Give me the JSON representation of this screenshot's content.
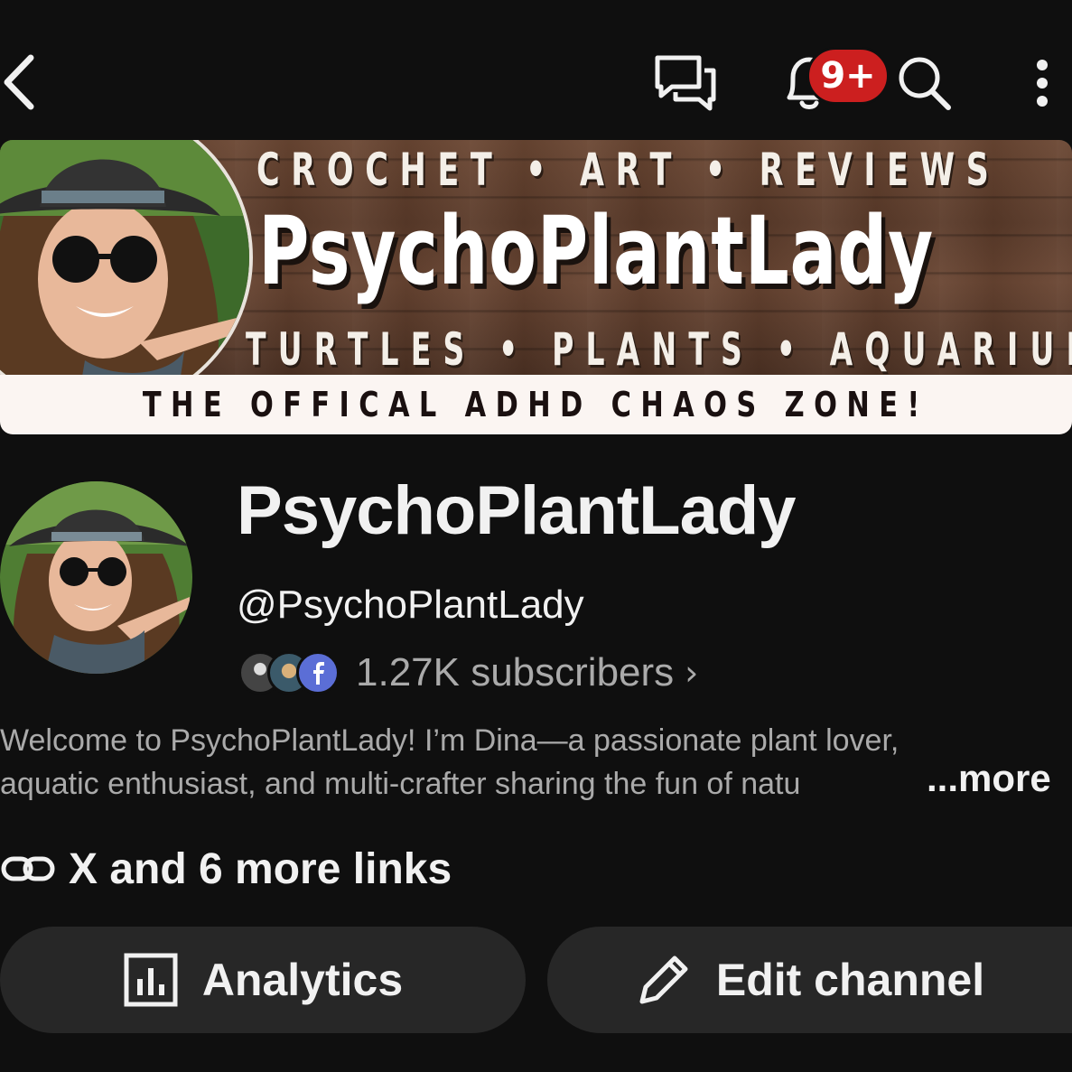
{
  "topbar": {
    "back_icon": "chevron-left-icon",
    "icons": [
      "chat-icon",
      "bell-icon",
      "search-icon",
      "more-vert-icon"
    ],
    "notification_badge": "9+",
    "badge_color": "#cc1f1f"
  },
  "banner": {
    "top_line": "CROCHET • ART • REVIEWS",
    "title": "PsychoPlantLady",
    "bottom_line": "TURTLES • PLANTS • AQUARIUMS",
    "strip_text": "THE OFFICAL ADHD CHAOS ZONE!"
  },
  "profile": {
    "channel_name": "PsychoPlantLady",
    "handle": "@PsychoPlantLady",
    "subscribers": "1.27K subscribers",
    "description_line1": "Welcome to PsychoPlantLady! I’m Dina—a passionate plant lover,",
    "description_line2": "aquatic enthusiast, and multi-crafter sharing the fun of natu",
    "more_label": "...more",
    "links_label": "X and 6 more links"
  },
  "actions": {
    "analytics_label": "Analytics",
    "edit_label": "Edit channel"
  },
  "colors": {
    "background": "#0f0f0f",
    "pill": "#272727",
    "muted_text": "#aaaaaa"
  }
}
